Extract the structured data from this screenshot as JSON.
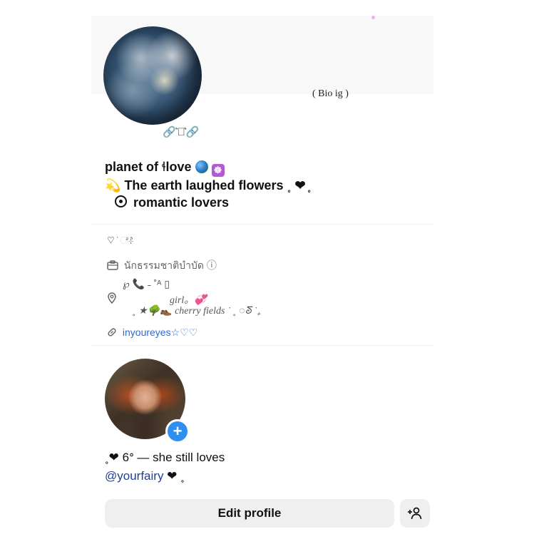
{
  "header": {
    "bio_tag": "( Bio  ig )",
    "name_deco": "🔗͛✧͛🔗"
  },
  "bio": {
    "name_text": "planet of ",
    "name_love": "love",
    "name_l_char": "ɬ",
    "line2_prefix": "💫",
    "line2_text": "The earth laughed flowers",
    "line2_suffix": "˳ ❤ ̥",
    "line3_text": "romantic lovers"
  },
  "info": {
    "deco_line": "♡ ̇ ೆ⊹͛",
    "job_icon": "briefcase-icon",
    "job_text": "นักธรรมชาติบำบัด",
    "job_info_icon": "ⓘ",
    "location_icon": "pin-icon",
    "location_line1": "℘ 📞 ˗ ˚ᴬ  ▯",
    "location_line2": "girl。💞",
    "location_line3": "˳ ★🌳👞 cherry fields ˙  ˳ ◌ᘕ ˙₊",
    "link_text": "inyoureyes☆♡♡"
  },
  "story": {
    "add_symbol": "+"
  },
  "caption": {
    "line1": "˳❤ 6ᐤ — she still loves",
    "mention": "@yourfairy",
    "mention_suffix": " ❤ ˳"
  },
  "actions": {
    "edit_profile_label": "Edit profile",
    "add_person_icon": "add-person-icon"
  },
  "colors": {
    "link": "#2d6bd0",
    "mention": "#1f3f8f",
    "story_plus": "#2f8ff0",
    "button_bg": "#efefef"
  }
}
